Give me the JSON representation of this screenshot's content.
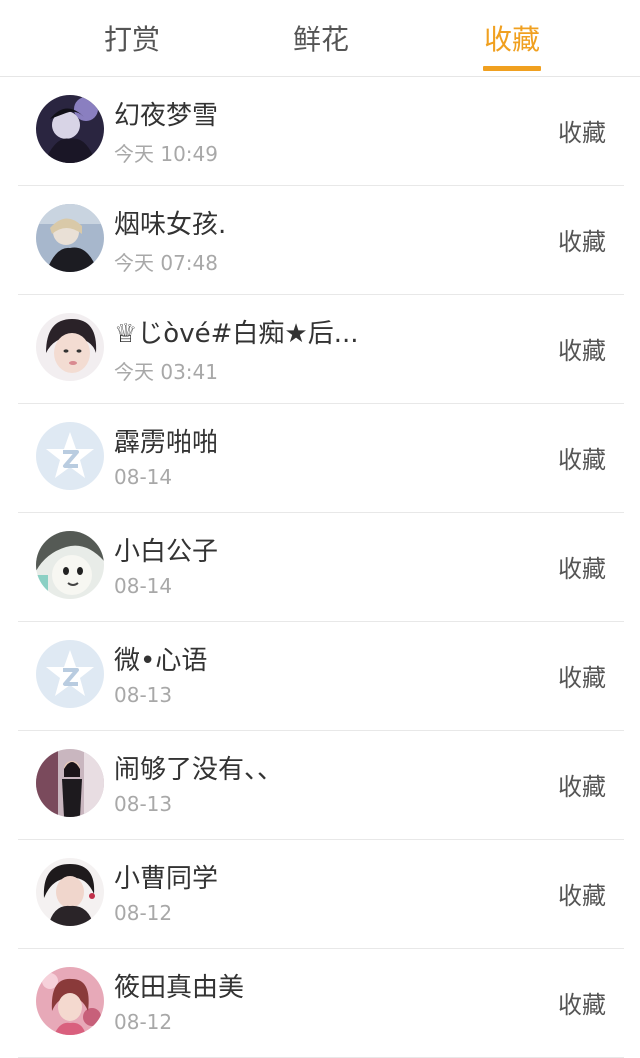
{
  "tabs": [
    {
      "label": "打赏"
    },
    {
      "label": "鲜花"
    },
    {
      "label": "收藏"
    }
  ],
  "accent_color": "#f0a020",
  "items": [
    {
      "name": "幻夜梦雪",
      "time": "今天 10:49",
      "action": "收藏",
      "avatar": "photo"
    },
    {
      "name": "烟味女孩.",
      "time": "今天 07:48",
      "action": "收藏",
      "avatar": "photo"
    },
    {
      "name": "♕じòvé#白痴★后...",
      "time": "今天 03:41",
      "action": "收藏",
      "avatar": "photo"
    },
    {
      "name": "霹雳啪啪",
      "time": "08-14",
      "action": "收藏",
      "avatar": "qzone-default"
    },
    {
      "name": "小白公子",
      "time": "08-14",
      "action": "收藏",
      "avatar": "photo"
    },
    {
      "name": "微•心语",
      "time": "08-13",
      "action": "收藏",
      "avatar": "qzone-default"
    },
    {
      "name": "闹够了没有、、",
      "time": "08-13",
      "action": "收藏",
      "avatar": "photo"
    },
    {
      "name": "小曹同学",
      "time": "08-12",
      "action": "收藏",
      "avatar": "photo"
    },
    {
      "name": "筱田真由美",
      "time": "08-12",
      "action": "收藏",
      "avatar": "photo"
    }
  ]
}
